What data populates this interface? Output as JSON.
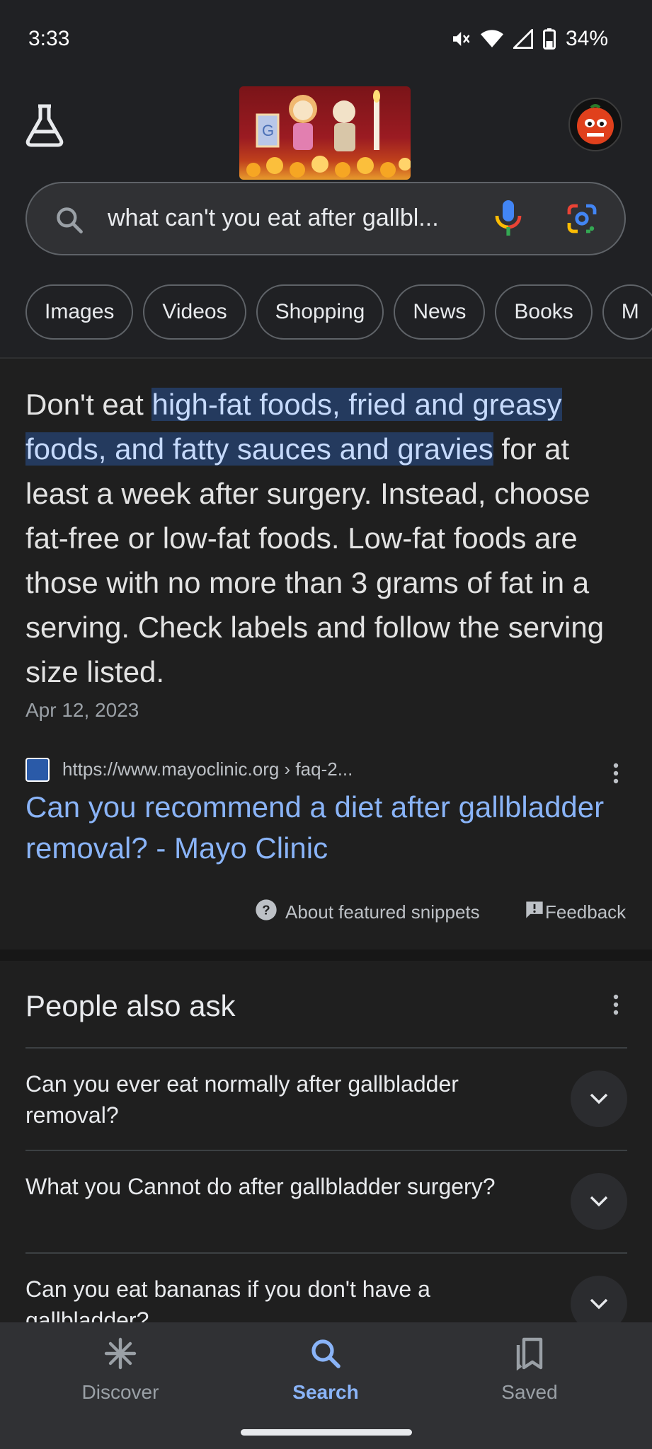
{
  "status_bar": {
    "time": "3:33",
    "battery": "34%",
    "icons": [
      "mute-icon",
      "wifi-icon",
      "signal-icon",
      "battery-icon"
    ]
  },
  "header": {
    "search_query": "what can't you eat after gallbl...",
    "colors": {
      "mic_blue": "#4285f4",
      "mic_red": "#ea4335",
      "mic_green": "#34a853",
      "mic_yellow": "#fbbc04"
    }
  },
  "chips": [
    "Images",
    "Videos",
    "Shopping",
    "News",
    "Books",
    "M"
  ],
  "featured_snippet": {
    "lead": "Don't eat ",
    "highlight": "high-fat foods, fried and greasy foods, and fatty sauces and gravies",
    "rest": " for at least a week after surgery. Instead, choose fat-free or low-fat foods. Low-fat foods are those with no more than 3 grams of fat in a serving. Check labels and follow the serving size listed.",
    "date": "Apr 12, 2023",
    "source_url": "https://www.mayoclinic.org › faq-2...",
    "result_title": "Can you recommend a diet after gallbladder removal? - Mayo Clinic",
    "about_label": "About featured snippets",
    "feedback_label": "Feedback"
  },
  "people_also_ask": {
    "title": "People also ask",
    "questions": [
      "Can you ever eat normally after gallbladder removal?",
      "What you Cannot do after gallbladder surgery?",
      "Can you eat bananas if you don't have a gallbladder?"
    ]
  },
  "bottom_nav": {
    "items": [
      {
        "label": "Discover",
        "icon": "asterisk-icon"
      },
      {
        "label": "Search",
        "icon": "search-icon",
        "active": true
      },
      {
        "label": "Saved",
        "icon": "bookmark-icon"
      }
    ],
    "accent": "#8ab4f8"
  }
}
